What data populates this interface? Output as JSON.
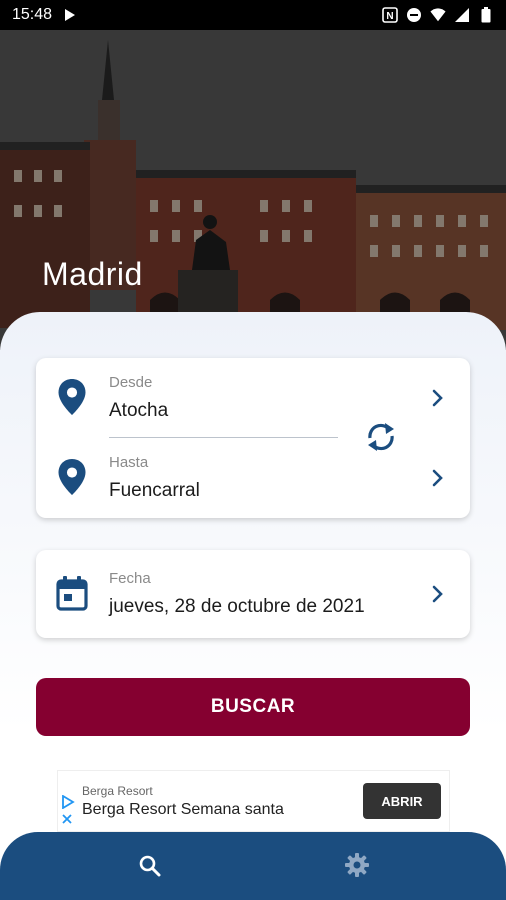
{
  "status_bar": {
    "time": "15:48"
  },
  "hero": {
    "city": "Madrid"
  },
  "route": {
    "from_label": "Desde",
    "from_value": "Atocha",
    "to_label": "Hasta",
    "to_value": "Fuencarral"
  },
  "date": {
    "label": "Fecha",
    "value": "jueves, 28 de octubre de 2021"
  },
  "search_button": "BUSCAR",
  "ad": {
    "brand": "Berga Resort",
    "title": "Berga Resort Semana santa",
    "cta": "ABRIR"
  },
  "colors": {
    "primary": "#1b4d7f",
    "accent": "#850030"
  },
  "icons": [
    "play-store-icon",
    "nfc-icon",
    "dnd-icon",
    "wifi-icon",
    "signal-icon",
    "battery-icon",
    "location-pin-icon",
    "swap-icon",
    "calendar-icon",
    "chevron-right-icon",
    "search-icon",
    "gear-icon"
  ]
}
